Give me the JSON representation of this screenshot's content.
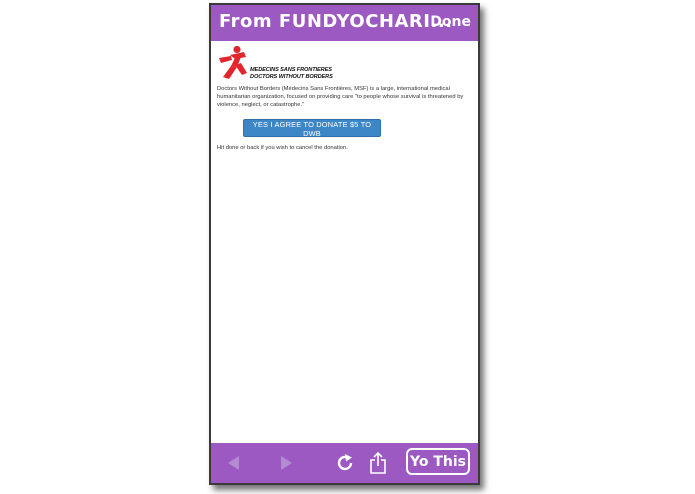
{
  "header": {
    "title": "From  FUNDYOCHARI...",
    "done_label": "Done"
  },
  "content": {
    "logo": {
      "line1": "MEDECINS SANS FRONTIERES",
      "line2": "DOCTORS WITHOUT BORDERS",
      "icon": "msf-runner-logo",
      "color": "#e3262e"
    },
    "description": "Doctors Without Borders (Médecins Sans Frontières, MSF) is a large, international medical humanitarian organization, focused on providing care \"to people whose survival is threatened by violence, neglect, or catastrophe.\"",
    "donate_button_label": "YES I AGREE TO DONATE $5 TO DWB",
    "hint": "Hit done or back if you wish to cancel the donation."
  },
  "toolbar": {
    "back_icon": "back-arrow-icon",
    "forward_icon": "forward-arrow-icon",
    "refresh_icon": "refresh-icon",
    "share_icon": "share-icon",
    "yo_label": "Yo This"
  },
  "colors": {
    "bar": "#9b59c1",
    "button": "#3d87c7",
    "disabled_icon": "#b48bd3"
  }
}
